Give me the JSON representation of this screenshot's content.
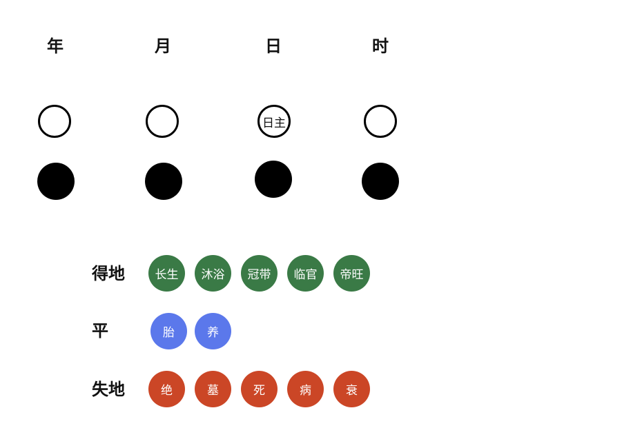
{
  "pillars": [
    {
      "label": "年",
      "stem_text": ""
    },
    {
      "label": "月",
      "stem_text": ""
    },
    {
      "label": "日",
      "stem_text": "日主"
    },
    {
      "label": "时",
      "stem_text": ""
    }
  ],
  "legend": {
    "good": {
      "label": "得地",
      "color": "#3a7a46",
      "stages": [
        "长生",
        "沐浴",
        "冠带",
        "临官",
        "帝旺"
      ]
    },
    "neutral": {
      "label": "平",
      "color": "#5b78eb",
      "stages": [
        "胎",
        "养"
      ]
    },
    "bad": {
      "label": "失地",
      "color": "#cb4626",
      "stages": [
        "绝",
        "墓",
        "死",
        "病",
        "衰"
      ]
    }
  }
}
